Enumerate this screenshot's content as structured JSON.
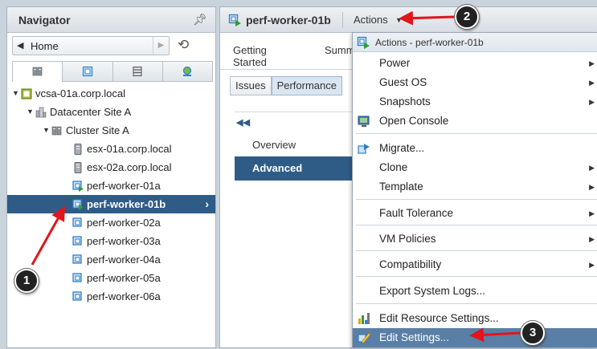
{
  "navigator": {
    "title": "Navigator",
    "home_label": "Home",
    "tabs": [
      "hosts-clusters",
      "vms-templates",
      "storage",
      "networking"
    ],
    "tree": [
      {
        "label": "vcsa-01a.corp.local",
        "level": 0,
        "expander": "▼",
        "icon": "vcenter-icon"
      },
      {
        "label": "Datacenter Site A",
        "level": 1,
        "expander": "▼",
        "icon": "datacenter-icon"
      },
      {
        "label": "Cluster Site A",
        "level": 2,
        "expander": "▼",
        "icon": "cluster-icon"
      },
      {
        "label": "esx-01a.corp.local",
        "level": 3,
        "expander": "",
        "icon": "host-icon"
      },
      {
        "label": "esx-02a.corp.local",
        "level": 3,
        "expander": "",
        "icon": "host-icon"
      },
      {
        "label": "perf-worker-01a",
        "level": 3,
        "expander": "",
        "icon": "vm-on-icon"
      },
      {
        "label": "perf-worker-01b",
        "level": 3,
        "expander": "",
        "icon": "vm-on-icon",
        "selected": true
      },
      {
        "label": "perf-worker-02a",
        "level": 3,
        "expander": "",
        "icon": "vm-icon"
      },
      {
        "label": "perf-worker-03a",
        "level": 3,
        "expander": "",
        "icon": "vm-icon"
      },
      {
        "label": "perf-worker-04a",
        "level": 3,
        "expander": "",
        "icon": "vm-icon"
      },
      {
        "label": "perf-worker-05a",
        "level": 3,
        "expander": "",
        "icon": "vm-icon"
      },
      {
        "label": "perf-worker-06a",
        "level": 3,
        "expander": "",
        "icon": "vm-icon"
      }
    ]
  },
  "content": {
    "vm_title": "perf-worker-01b",
    "actions_label": "Actions",
    "subtabs": [
      "Getting Started",
      "Summ"
    ],
    "buttons": [
      "Issues",
      "Performance"
    ],
    "side_items": [
      "Overview",
      "Advanced"
    ]
  },
  "menu": {
    "header": "Actions - perf-worker-01b",
    "items": {
      "power": "Power",
      "guest_os": "Guest OS",
      "snapshots": "Snapshots",
      "open_console": "Open Console",
      "migrate": "Migrate...",
      "clone": "Clone",
      "template": "Template",
      "fault_tolerance": "Fault Tolerance",
      "vm_policies": "VM Policies",
      "compatibility": "Compatibility",
      "export_logs": "Export System Logs...",
      "edit_resource": "Edit Resource Settings...",
      "edit_settings": "Edit Settings..."
    }
  },
  "annotations": {
    "badge1": "1",
    "badge2": "2",
    "badge3": "3",
    "arrow_color": "#e0161c"
  },
  "colors": {
    "selection": "#2f5c87",
    "menu_highlight": "#5a7fa6",
    "vm_icon": "#2f7fc8",
    "power_on": "#2aa02a"
  }
}
